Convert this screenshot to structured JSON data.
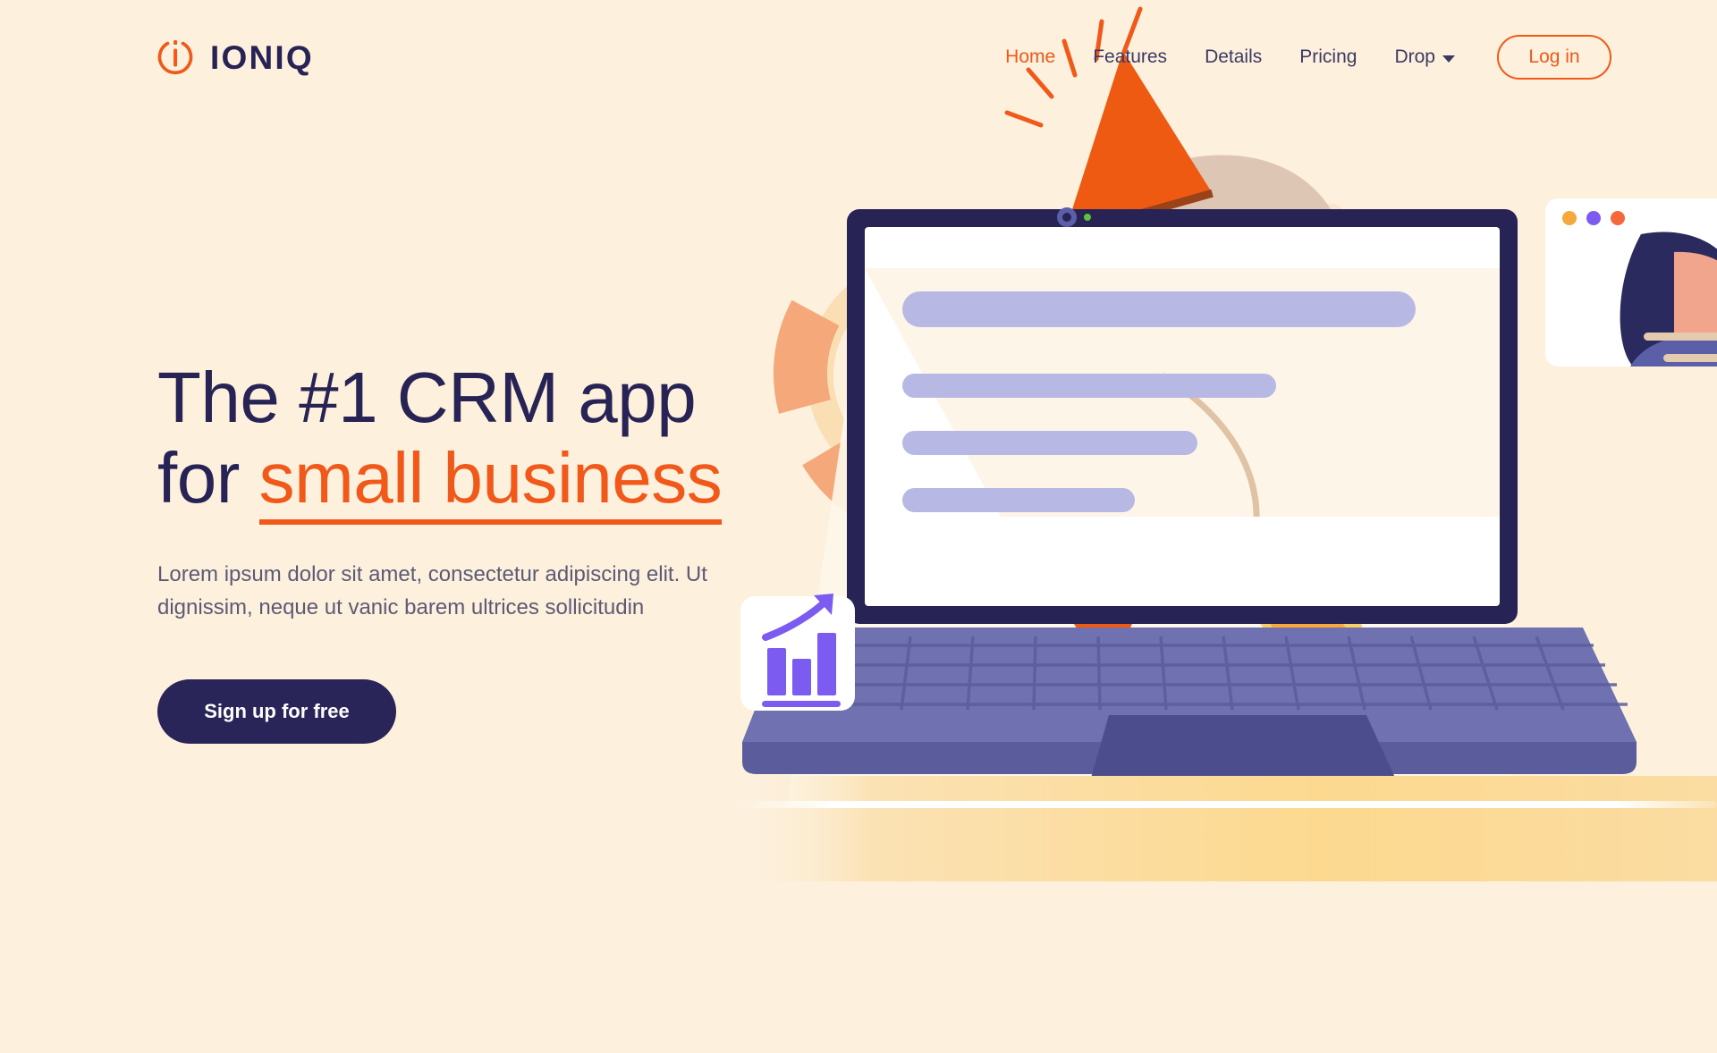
{
  "theme": {
    "background": "#fdf0dd",
    "navy": "#272455",
    "orange": "#f1591a",
    "muted_text": "#5c5a74",
    "lavender": "#b7b9e4",
    "laptop_body": "#6f71b0",
    "peach": "#f5a97a",
    "cream_arc": "#fbdfb4",
    "purple_icon": "#7c5cf0"
  },
  "brand": {
    "name": "IONIQ",
    "logo_icon": "power-i-circle-icon"
  },
  "nav": {
    "items": [
      {
        "label": "Home",
        "active": true,
        "has_caret": false
      },
      {
        "label": "Features",
        "active": false,
        "has_caret": false
      },
      {
        "label": "Details",
        "active": false,
        "has_caret": false
      },
      {
        "label": "Pricing",
        "active": false,
        "has_caret": false
      },
      {
        "label": "Drop",
        "active": false,
        "has_caret": true
      }
    ],
    "login_label": "Log in"
  },
  "hero": {
    "headline_line1": "The #1 CRM app",
    "headline_line2_prefix": "for ",
    "headline_accent": "small business",
    "subhead": "Lorem ipsum dolor sit amet, consectetur adipiscing elit. Ut dignissim, neque ut vanic barem ultrices sollicitudin",
    "cta_label": "Sign up for free"
  },
  "illustration": {
    "elements": [
      "rocket-illustration",
      "laptop-illustration",
      "donut-chart-decoration",
      "gear-decoration",
      "analytics-card",
      "profile-card",
      "desk-shelf"
    ],
    "analytics_card": {
      "icon": "bar-chart-growth-icon"
    },
    "profile_card": {
      "window_dots": [
        "#f3a93c",
        "#7c5cf0",
        "#f4683c"
      ],
      "avatar": "woman-avatar",
      "text_lines": 2
    },
    "laptop_screen_lines": 4
  }
}
